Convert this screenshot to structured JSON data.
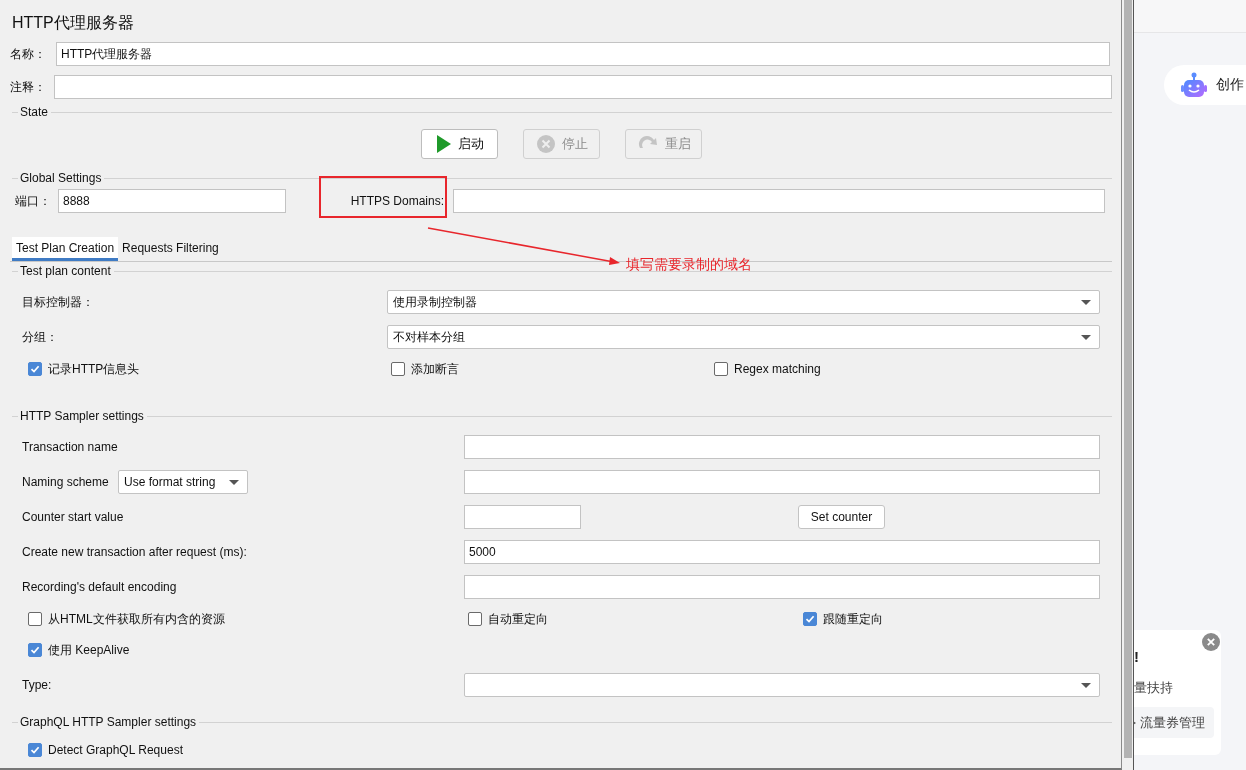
{
  "window": {
    "title": "HTTP代理服务器"
  },
  "name": {
    "label": "名称：",
    "value": "HTTP代理服务器"
  },
  "comment": {
    "label": "注释："
  },
  "state": {
    "legend": "State",
    "buttons": [
      {
        "kind": "start",
        "label": "启动",
        "disabled": false
      },
      {
        "kind": "stop",
        "label": "停止",
        "disabled": true
      },
      {
        "kind": "restart",
        "label": "重启",
        "disabled": true
      }
    ]
  },
  "global_settings": {
    "legend": "Global Settings",
    "port": {
      "label": "端口：",
      "value": "8888"
    },
    "https_domains": {
      "label": "HTTPS Domains:"
    }
  },
  "tabs": [
    {
      "label": "Test Plan Creation",
      "selected": true
    },
    {
      "label": "Requests Filtering",
      "selected": false
    }
  ],
  "test_plan_content": {
    "legend": "Test plan content",
    "target_controller": {
      "label": "目标控制器：",
      "value": "使用录制控制器"
    },
    "grouping": {
      "label": "分组：",
      "value": "不对样本分组"
    },
    "options": [
      {
        "label": "记录HTTP信息头",
        "checked": true
      },
      {
        "label": "添加断言",
        "checked": false
      },
      {
        "label": "Regex matching",
        "checked": false
      }
    ]
  },
  "http_sampler_settings": {
    "legend": "HTTP Sampler settings",
    "rows": [
      {
        "kind": "text",
        "label": "Transaction name"
      },
      {
        "kind": "naming",
        "label": "Naming scheme",
        "choice": "Use format string"
      },
      {
        "kind": "counter",
        "label": "Counter start value",
        "button": "Set counter"
      },
      {
        "kind": "text",
        "label": "Create new transaction after request (ms):",
        "value": "5000"
      },
      {
        "kind": "text",
        "label": "Recording's default encoding"
      }
    ],
    "options": [
      {
        "label": "从HTML文件获取所有内含的资源",
        "checked": false
      },
      {
        "label": "自动重定向",
        "checked": false
      },
      {
        "label": "跟随重定向",
        "checked": true
      }
    ],
    "keepalive": {
      "label": "使用 KeepAlive",
      "checked": true
    },
    "type": {
      "label": "Type:"
    }
  },
  "graphql": {
    "legend": "GraphQL HTTP Sampler settings",
    "options": [
      {
        "label": "Detect GraphQL Request",
        "checked": true
      }
    ]
  },
  "annotation": {
    "text": "填写需要录制的域名"
  },
  "side_panel": {
    "assistant": "创作",
    "promo": {
      "title": "!",
      "text": "量扶持",
      "button": "流量券管理"
    }
  }
}
